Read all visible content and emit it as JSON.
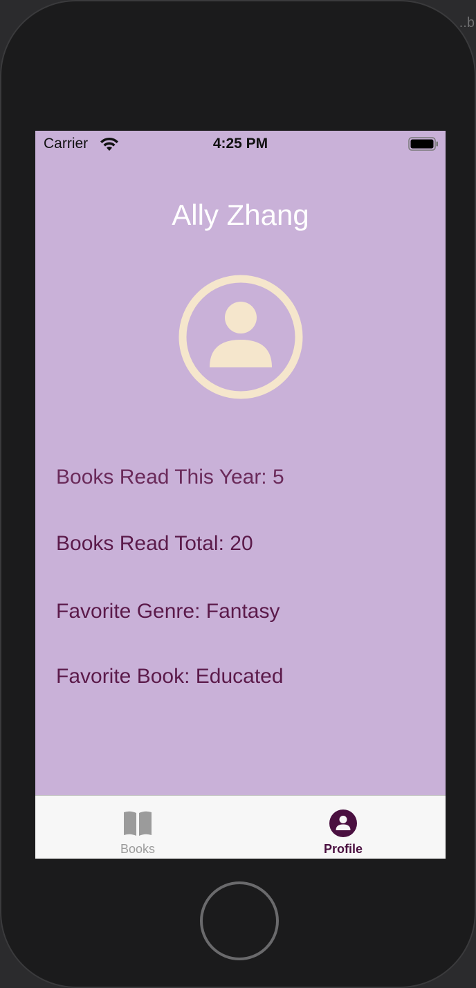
{
  "device": {
    "corner_text": "..b"
  },
  "status_bar": {
    "carrier": "Carrier",
    "time": "4:25 PM",
    "icons": [
      "wifi-icon",
      "battery-icon"
    ]
  },
  "profile": {
    "name": "Ally Zhang",
    "avatar_icon": "person-circle-icon",
    "avatar_color": "#f5e6cc",
    "background_color": "#c9b1d8",
    "stats": [
      {
        "text": "Books Read This Year: 5"
      },
      {
        "text": "Books Read Total: 20"
      },
      {
        "text": "Favorite Genre: Fantasy"
      },
      {
        "text": "Favorite Book: Educated"
      }
    ]
  },
  "tab_bar": {
    "tabs": [
      {
        "label": "Books",
        "icon": "book-icon",
        "selected": false
      },
      {
        "label": "Profile",
        "icon": "person-circle-icon",
        "selected": true
      }
    ],
    "selected_color": "#4a1040",
    "unselected_color": "#9b9b9b"
  }
}
